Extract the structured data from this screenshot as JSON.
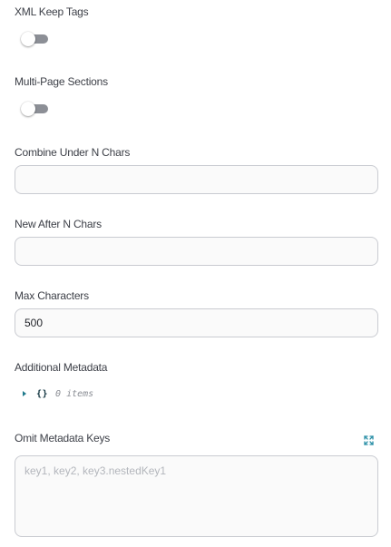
{
  "fields": {
    "xml_keep_tags": {
      "label": "XML Keep Tags",
      "enabled": false
    },
    "multi_page_sections": {
      "label": "Multi-Page Sections",
      "enabled": false
    },
    "combine_under_n_chars": {
      "label": "Combine Under N Chars",
      "value": ""
    },
    "new_after_n_chars": {
      "label": "New After N Chars",
      "value": ""
    },
    "max_characters": {
      "label": "Max Characters",
      "value": "500"
    },
    "additional_metadata": {
      "label": "Additional Metadata",
      "braces": "{}",
      "count_text": "0 items"
    },
    "omit_metadata_keys": {
      "label": "Omit Metadata Keys",
      "placeholder": "key1, key2, key3.nestedKey1",
      "expand_icon": "expand-icon"
    }
  },
  "colors": {
    "toggle_track": "#8c8f96",
    "input_border": "#c9cbd1",
    "accent": "#1f7a8c"
  }
}
